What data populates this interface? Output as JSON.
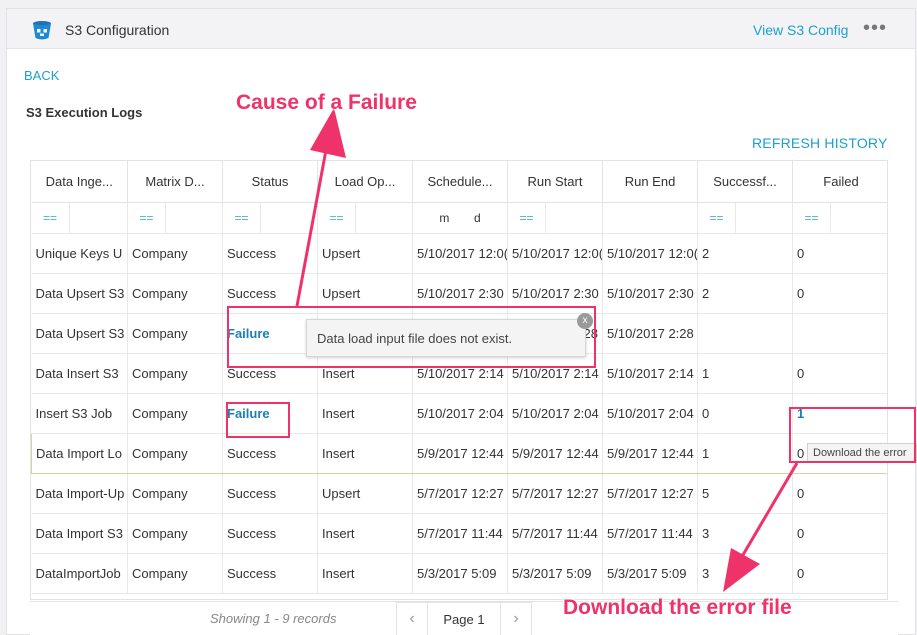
{
  "header": {
    "title": "S3 Configuration",
    "view_config": "View S3 Config",
    "more": "•••"
  },
  "nav": {
    "back": "BACK"
  },
  "section": {
    "title": "S3 Execution Logs",
    "refresh": "REFRESH HISTORY"
  },
  "grid": {
    "columns": [
      "Data Inge...",
      "Matrix D...",
      "Status",
      "Load Op...",
      "Schedule...",
      "Run Start",
      "Run End",
      "Successf...",
      "Failed"
    ],
    "filter_eq": "==",
    "date_filter": {
      "m": "m",
      "d": "d"
    },
    "rows": [
      [
        "Unique Keys U",
        "Company",
        "Success",
        "Upsert",
        "5/10/2017 12:0(",
        "5/10/2017 12:0(",
        "5/10/2017 12:0(",
        "2",
        "0"
      ],
      [
        "Data Upsert S3",
        "Company",
        "Success",
        "Upsert",
        "5/10/2017 2:30",
        "5/10/2017 2:30",
        "5/10/2017 2:30",
        "2",
        "0"
      ],
      [
        "Data Upsert S3",
        "Company",
        "Failure",
        "",
        "",
        ":28",
        "5/10/2017 2:28",
        "",
        ""
      ],
      [
        "Data Insert S3",
        "Company",
        "Success",
        "Insert",
        "5/10/2017 2:14",
        "5/10/2017 2:14",
        "5/10/2017 2:14",
        "1",
        "0"
      ],
      [
        "Insert S3 Job",
        "Company",
        "Failure",
        "Insert",
        "5/10/2017 2:04",
        "5/10/2017 2:04",
        "5/10/2017 2:04",
        "0",
        "1"
      ],
      [
        "Data Import Lo",
        "Company",
        "Success",
        "Insert",
        "5/9/2017 12:44",
        "5/9/2017 12:44",
        "5/9/2017 12:44",
        "1",
        "0"
      ],
      [
        "Data Import-Up",
        "Company",
        "Success",
        "Upsert",
        "5/7/2017 12:27",
        "5/7/2017 12:27",
        "5/7/2017 12:27",
        "5",
        "0"
      ],
      [
        "Data Import S3",
        "Company",
        "Success",
        "Insert",
        "5/7/2017 11:44",
        "5/7/2017 11:44",
        "5/7/2017 11:44",
        "3",
        "0"
      ],
      [
        "DataImportJob",
        "Company",
        "Success",
        "Insert",
        "5/3/2017 5:09",
        "5/3/2017 5:09",
        "5/3/2017 5:09",
        "3",
        "0"
      ]
    ]
  },
  "pager": {
    "showing": "Showing 1 - 9 records",
    "page": "Page 1",
    "prev": "‹",
    "next": "›"
  },
  "tooltips": {
    "failure_message": "Data load input file does not exist.",
    "close": "x",
    "download": "Download the error"
  },
  "annotations": {
    "cause": "Cause of a Failure",
    "download": "Download the error file"
  },
  "colors": {
    "accent": "#1ca0cf",
    "annotation": "#f0326b",
    "failure_link": "#1a7fb5"
  },
  "icons": {
    "app": "s3-bucket-icon",
    "more": "more-dots-icon",
    "close": "close-icon",
    "prev": "chevron-left-icon",
    "next": "chevron-right-icon"
  }
}
